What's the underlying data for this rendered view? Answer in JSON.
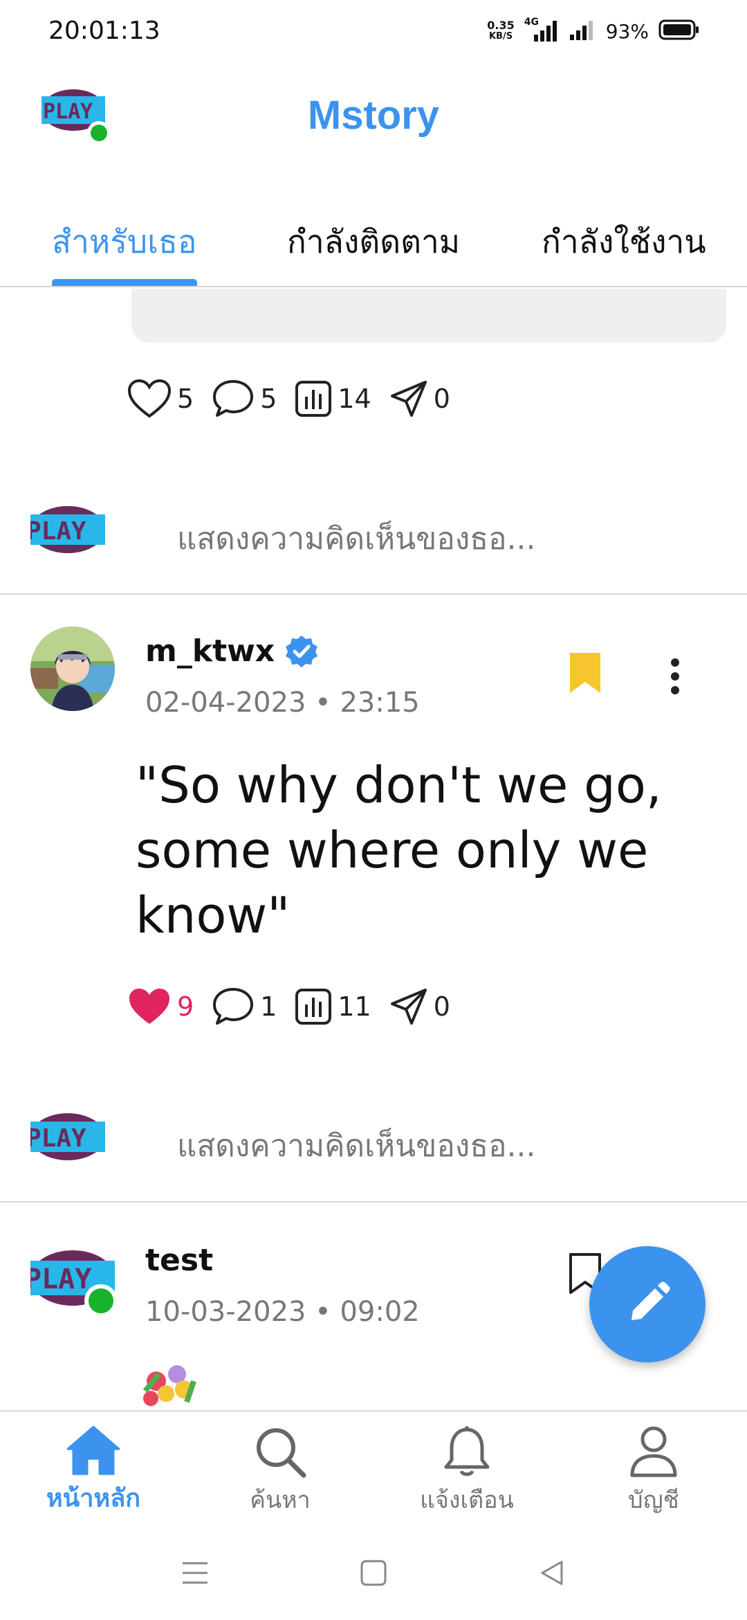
{
  "status_bar": {
    "time": "20:01:13",
    "speed_value": "0.35",
    "speed_unit": "KB/S",
    "network": "4G",
    "battery": "93%"
  },
  "header": {
    "title": "Mstory",
    "avatar_icon": "play-logo-avatar"
  },
  "tabs": [
    {
      "label": "สำหรับเธอ",
      "active": true
    },
    {
      "label": "กำลังติดตาม",
      "active": false
    },
    {
      "label": "กำลังใช้งาน",
      "active": false
    }
  ],
  "feed": {
    "post1": {
      "likes": "5",
      "comments": "5",
      "views": "14",
      "shares": "0",
      "comment_placeholder": "แสดงความคิดเห็นของธอ..."
    },
    "post2": {
      "username": "m_ktwx",
      "verified": true,
      "timestamp": "02-04-2023 • 23:15",
      "text": "\"So why don't we go, some where only we know\"",
      "likes": "9",
      "liked": true,
      "comments": "1",
      "views": "11",
      "shares": "0",
      "bookmarked": true,
      "comment_placeholder": "แสดงความคิดเห็นของธอ..."
    },
    "post3": {
      "username": "test",
      "timestamp": "10-03-2023 • 09:02",
      "bookmarked": false,
      "content_icon": "bouquet-emoji"
    }
  },
  "bottom_nav": [
    {
      "label": "หน้าหลัก",
      "icon": "home-icon",
      "active": true
    },
    {
      "label": "ค้นหา",
      "icon": "search-icon",
      "active": false
    },
    {
      "label": "แจ้งเตือน",
      "icon": "bell-icon",
      "active": false
    },
    {
      "label": "บัญชี",
      "icon": "user-icon",
      "active": false
    }
  ],
  "colors": {
    "accent": "#3b93ee",
    "like": "#e0245e",
    "bookmark": "#f7c62f",
    "online": "#19b32b"
  }
}
